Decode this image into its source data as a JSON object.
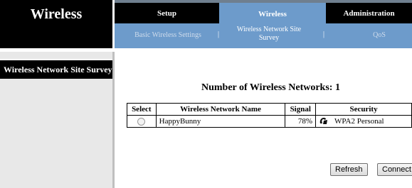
{
  "brand": {
    "title": "Wireless"
  },
  "nav": {
    "tabs": [
      {
        "label": "Setup"
      },
      {
        "label": "Wireless"
      },
      {
        "label": "Administration"
      }
    ]
  },
  "subnav": {
    "basic": "Basic Wireless Settings",
    "separator": "|",
    "survey": "Wireless Network Site Survey",
    "qos": "QoS"
  },
  "side": {
    "heading": "Wireless Network Site Survey"
  },
  "main": {
    "count_text": "Number of Wireless Networks: 1",
    "columns": [
      "Select",
      "Wireless Network Name",
      "Signal",
      "Security"
    ],
    "rows": [
      {
        "name": "HappyBunny",
        "signal": "78%",
        "security": "WPA2 Personal",
        "icon": "lock-icon"
      }
    ],
    "refresh_label": "Refresh",
    "connect_label": "Connect"
  }
}
